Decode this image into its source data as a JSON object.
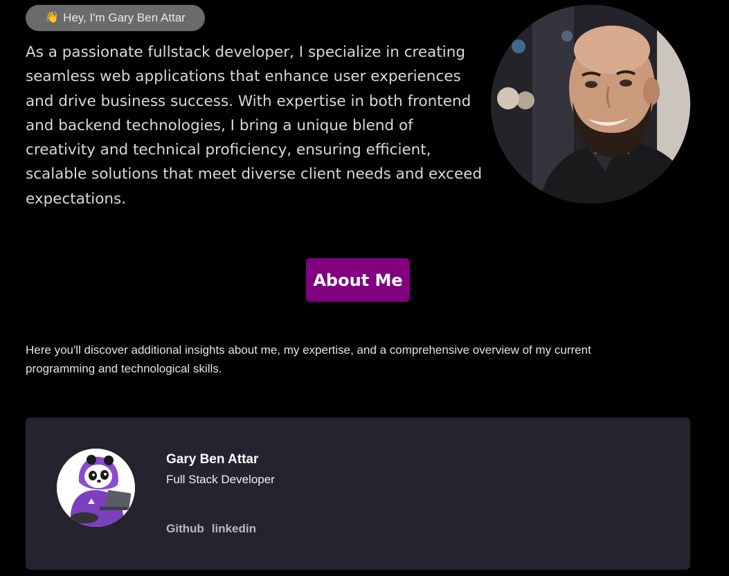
{
  "hero": {
    "greeting_icon": "waving-hand",
    "greeting_emoji": "👋",
    "greeting_text": "Hey, I'm Gary Ben Attar",
    "intro": "As a passionate fullstack developer, I specialize in creating seamless web applications that enhance user experiences and drive business success. With expertise in both frontend and backend technologies, I bring a unique blend of creativity and technical proficiency, ensuring efficient, scalable solutions that meet diverse client needs and exceed expectations."
  },
  "about": {
    "button_label": "About Me",
    "button_color": "#800080",
    "description": "Here you'll discover additional insights about me, my expertise, and a comprehensive overview of my current programming and technological skills."
  },
  "card": {
    "name": "Gary Ben Attar",
    "role": "Full Stack Developer",
    "links": [
      "Github",
      "linkedin"
    ],
    "background": "#26222f"
  }
}
